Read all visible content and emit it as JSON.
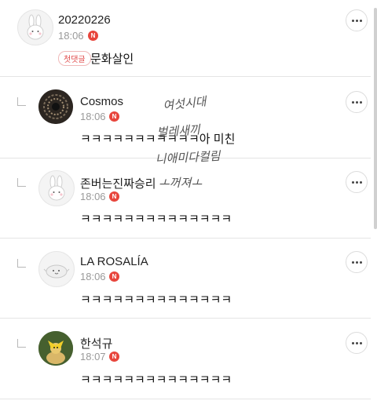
{
  "comments": [
    {
      "name": "20220226",
      "time": "18:06",
      "badge": "N",
      "tag": "첫댓글",
      "text": "문화살인",
      "avatar_icon": "rabbit-avatar-icon"
    },
    {
      "name": "Cosmos",
      "time": "18:06",
      "badge": "N",
      "text": "ㅋㅋㅋㅋㅋㅋㅋㅋㅋㅋㅋ아 미친",
      "avatar_icon": "spiral-galaxy-avatar"
    },
    {
      "name": "존버는진짜승리",
      "time": "18:06",
      "badge": "N",
      "text": "ㅋㅋㅋㅋㅋㅋㅋㅋㅋㅋㅋㅋㅋㅋ",
      "avatar_icon": "rabbit-avatar-icon"
    },
    {
      "name": "LA ROSALÍA",
      "time": "18:06",
      "badge": "N",
      "text": "ㅋㅋㅋㅋㅋㅋㅋㅋㅋㅋㅋㅋㅋㅋ",
      "avatar_icon": "seal-avatar-icon"
    },
    {
      "name": "한석규",
      "time": "18:07",
      "badge": "N",
      "text": "ㅋㅋㅋㅋㅋㅋㅋㅋㅋㅋㅋㅋㅋㅋ",
      "avatar_icon": "chick-photo-avatar"
    }
  ],
  "handwriting_lines": [
    "여섯시대",
    "벌레새끼",
    "니애미다컬림",
    "ㅗ꺼져ㅗ"
  ],
  "colors": {
    "badge": "#e8453c",
    "divider": "#e4e4e4",
    "time": "#9a9a9a"
  }
}
